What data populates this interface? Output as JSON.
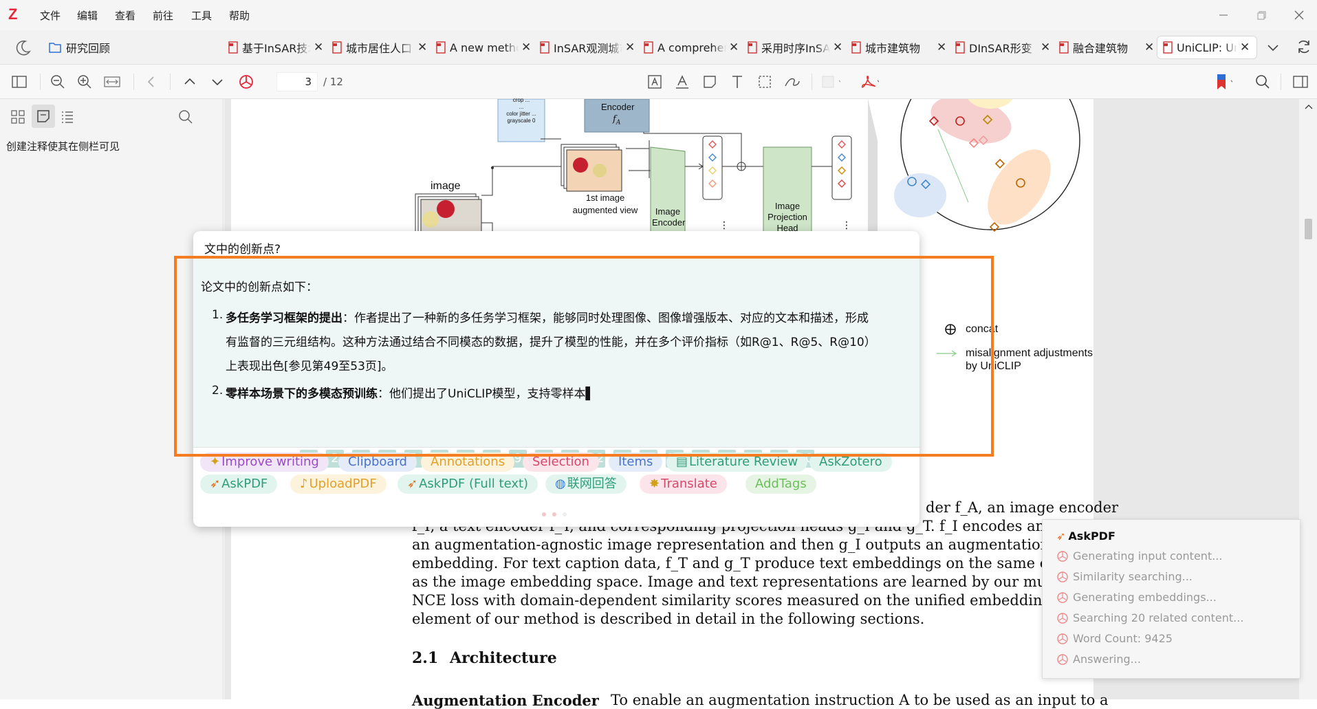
{
  "app": {
    "logo": "Z"
  },
  "menu": [
    "文件",
    "编辑",
    "查看",
    "前往",
    "工具",
    "帮助"
  ],
  "tabs": {
    "library": "研究回顾",
    "items": [
      "基于InSAR技术",
      "城市居住人口",
      "A new method",
      "InSAR观测城市",
      "A comprehensive",
      "采用时序InSAR",
      "城市建筑物",
      "DInSAR形变",
      "融合建筑物",
      "UniCLIP: Unified"
    ]
  },
  "toolbar": {
    "page_current": "3",
    "page_total": "/ 12"
  },
  "sidebar": {
    "empty_hint": "创建注释使其在侧栏可见"
  },
  "figure": {
    "image_label": "image",
    "aug_small": [
      "crop ...",
      "...",
      "color jitter ...",
      "grayscale 0"
    ],
    "aug_encoder": "Encoder",
    "aug_encoder_sym": "f_A",
    "first_aug_label": "1st image",
    "first_aug_label2": "augmented view",
    "image_encoder": [
      "Image",
      "Encoder"
    ],
    "projection": [
      "Image",
      "Projection",
      "Head"
    ],
    "legend_concat": "concat",
    "legend_mis": "misalignment adjustments",
    "legend_mis2": "by UniCLIP"
  },
  "document": {
    "line0": "der f_A, an image encoder",
    "line1": "f_I, a text encoder f_T, and corresponding projection heads g_I and g_T.  f_I encodes an i",
    "line2": "an augmentation-agnostic image representation and then g_I outputs an augmentation-awar",
    "line3": "embedding. For text caption data, f_T and g_T produce text embeddings on the same embeddi",
    "line4": "as the image embedding space.  Image and text representations are learned by our multi-",
    "line5": "NCE loss with domain-dependent similarity scores measured on the unified embedding spac",
    "line6": "element of our method is described in detail in the following sections.",
    "section_num": "2.1",
    "section_title": "Architecture",
    "next_line_bold": "Augmentation Encoder",
    "next_line": "To enable an augmentation instruction A to be used as an input to a"
  },
  "popup": {
    "question": "文中的创新点?",
    "answer_intro": "论文中的创新点如下：",
    "item1_num": "1.",
    "item1_title": "多任务学习框架的提出",
    "item1_l1": "：作者提出了一种新的多任务学习框架，能够同时处理图像、图像增强版本、对应的文本和描述，形成",
    "item1_l2": "有监督的三元组结构。这种方法通过结合不同模态的数据，提升了模型的性能，并在多个评价指标（如R@1、R@5、R@10）",
    "item1_l3": "上表现出色[参见第49至53页]。",
    "item2_num": "2.",
    "item2_title": "零样本场景下的多模态预训练",
    "item2_text": "：他们提出了UniCLIP模型，支持零样本",
    "cursor": "▌",
    "pages": [
      "1",
      "2",
      "3",
      "4",
      "5",
      "6",
      "7",
      "8",
      "9",
      "10",
      "11",
      "12",
      "13",
      "14",
      "15",
      "16",
      "17",
      "18",
      "19",
      "20"
    ],
    "buttons_row1": [
      "Improve writing",
      "Clipboard",
      "Annotations",
      "Selection",
      "Items",
      "Literature Review",
      "AskZotero"
    ],
    "buttons_row2": [
      "AskPDF",
      "UploadPDF",
      "AskPDF (Full text)",
      "联网回答",
      "Translate",
      "AddTags"
    ]
  },
  "status": {
    "title": "AskPDF",
    "steps": [
      "Generating input content...",
      "Similarity searching...",
      "Generating embeddings...",
      "Searching 20 related content...",
      "Word Count: 9425",
      "Answering..."
    ]
  },
  "colors": {
    "accent": "#f57c21",
    "answer_bg": "#eef7f5",
    "page_num": "#bfe0d8",
    "brand": "#e5263b"
  }
}
